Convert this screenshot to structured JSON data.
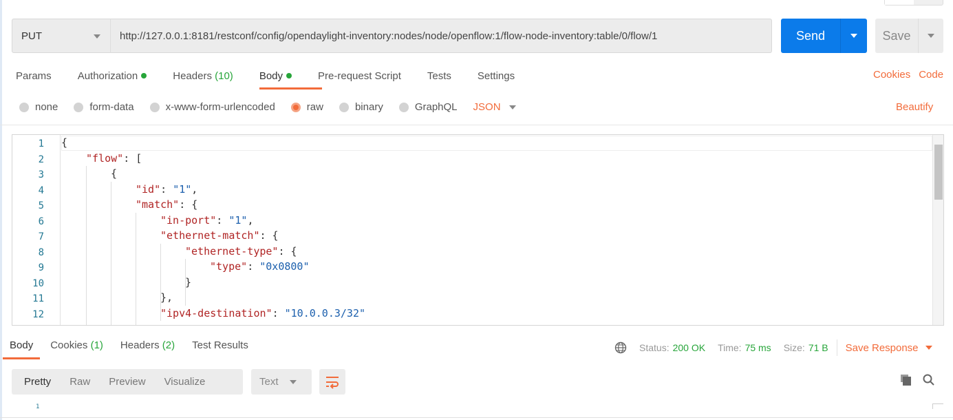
{
  "request": {
    "method": "PUT",
    "url": "http://127.0.0.1:8181/restconf/config/opendaylight-inventory:nodes/node/openflow:1/flow-node-inventory:table/0/flow/1",
    "send_label": "Send",
    "save_label": "Save"
  },
  "tabs": [
    {
      "label": "Params"
    },
    {
      "label": "Authorization",
      "dot": true
    },
    {
      "label": "Headers",
      "count": "(10)"
    },
    {
      "label": "Body",
      "dot": true,
      "active": true
    },
    {
      "label": "Pre-request Script"
    },
    {
      "label": "Tests"
    },
    {
      "label": "Settings"
    }
  ],
  "links": {
    "cookies": "Cookies",
    "code": "Code",
    "beautify": "Beautify"
  },
  "body_types": [
    {
      "label": "none"
    },
    {
      "label": "form-data"
    },
    {
      "label": "x-www-form-urlencoded"
    },
    {
      "label": "raw",
      "selected": true
    },
    {
      "label": "binary"
    },
    {
      "label": "GraphQL"
    }
  ],
  "raw_format": "JSON",
  "editor": {
    "lines": [
      {
        "n": "1",
        "indent": 0,
        "tokens": [
          [
            "p",
            "{"
          ]
        ]
      },
      {
        "n": "2",
        "indent": 1,
        "tokens": [
          [
            "k",
            "\"flow\""
          ],
          [
            "p",
            ": ["
          ]
        ]
      },
      {
        "n": "3",
        "indent": 2,
        "tokens": [
          [
            "p",
            "{"
          ]
        ]
      },
      {
        "n": "4",
        "indent": 3,
        "tokens": [
          [
            "k",
            "\"id\""
          ],
          [
            "p",
            ": "
          ],
          [
            "s",
            "\"1\""
          ],
          [
            "p",
            ","
          ]
        ]
      },
      {
        "n": "5",
        "indent": 3,
        "tokens": [
          [
            "k",
            "\"match\""
          ],
          [
            "p",
            ": {"
          ]
        ]
      },
      {
        "n": "6",
        "indent": 4,
        "tokens": [
          [
            "k",
            "\"in-port\""
          ],
          [
            "p",
            ": "
          ],
          [
            "s",
            "\"1\""
          ],
          [
            "p",
            ","
          ]
        ]
      },
      {
        "n": "7",
        "indent": 4,
        "tokens": [
          [
            "k",
            "\"ethernet-match\""
          ],
          [
            "p",
            ": {"
          ]
        ]
      },
      {
        "n": "8",
        "indent": 5,
        "tokens": [
          [
            "k",
            "\"ethernet-type\""
          ],
          [
            "p",
            ": {"
          ]
        ]
      },
      {
        "n": "9",
        "indent": 6,
        "tokens": [
          [
            "k",
            "\"type\""
          ],
          [
            "p",
            ": "
          ],
          [
            "s",
            "\"0x0800\""
          ]
        ]
      },
      {
        "n": "10",
        "indent": 5,
        "tokens": [
          [
            "p",
            "}"
          ]
        ]
      },
      {
        "n": "11",
        "indent": 4,
        "tokens": [
          [
            "p",
            "},"
          ]
        ]
      },
      {
        "n": "12",
        "indent": 4,
        "tokens": [
          [
            "k",
            "\"ipv4-destination\""
          ],
          [
            "p",
            ": "
          ],
          [
            "s",
            "\"10.0.0.3/32\""
          ]
        ]
      }
    ]
  },
  "response": {
    "tabs": [
      {
        "label": "Body",
        "active": true
      },
      {
        "label": "Cookies",
        "count": "(1)"
      },
      {
        "label": "Headers",
        "count": "(2)"
      },
      {
        "label": "Test Results"
      }
    ],
    "status_label": "Status:",
    "status": "200 OK",
    "time_label": "Time:",
    "time": "75 ms",
    "size_label": "Size:",
    "size": "71 B",
    "save_response": "Save Response",
    "views": [
      "Pretty",
      "Raw",
      "Preview",
      "Visualize"
    ],
    "active_view": "Pretty",
    "format": "Text",
    "first_line": "1"
  },
  "colors": {
    "accent": "#f26b3a",
    "primary": "#0b7bea",
    "success": "#27a53a"
  }
}
